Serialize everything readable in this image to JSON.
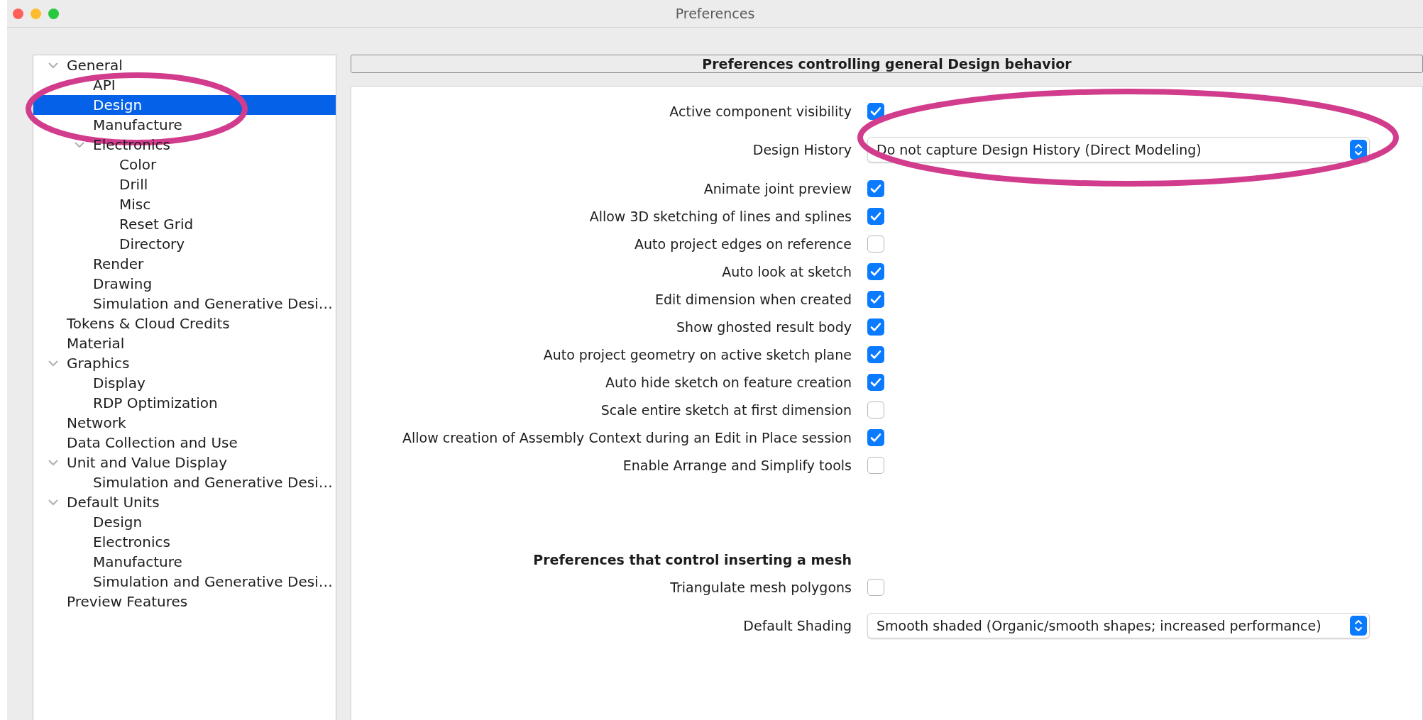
{
  "window": {
    "title": "Preferences"
  },
  "tree": [
    {
      "label": "General",
      "expanded": true,
      "selected": false,
      "children": [
        {
          "label": "API",
          "selected": false
        },
        {
          "label": "Design",
          "selected": true,
          "circled": true
        },
        {
          "label": "Manufacture",
          "selected": false
        },
        {
          "label": "Electronics",
          "expanded": true,
          "selected": false,
          "children": [
            {
              "label": "Color",
              "selected": false
            },
            {
              "label": "Drill",
              "selected": false
            },
            {
              "label": "Misc",
              "selected": false
            },
            {
              "label": "Reset Grid",
              "selected": false
            },
            {
              "label": "Directory",
              "selected": false
            }
          ]
        },
        {
          "label": "Render",
          "selected": false
        },
        {
          "label": "Drawing",
          "selected": false
        },
        {
          "label": "Simulation and Generative Desi…",
          "selected": false
        }
      ]
    },
    {
      "label": "Tokens & Cloud Credits",
      "selected": false
    },
    {
      "label": "Material",
      "selected": false
    },
    {
      "label": "Graphics",
      "expanded": true,
      "selected": false,
      "children": [
        {
          "label": "Display",
          "selected": false
        },
        {
          "label": "RDP Optimization",
          "selected": false
        }
      ]
    },
    {
      "label": "Network",
      "selected": false
    },
    {
      "label": "Data Collection and Use",
      "selected": false
    },
    {
      "label": "Unit and Value Display",
      "expanded": true,
      "selected": false,
      "children": [
        {
          "label": "Simulation and Generative Desi…",
          "selected": false
        }
      ]
    },
    {
      "label": "Default Units",
      "expanded": true,
      "selected": false,
      "children": [
        {
          "label": "Design",
          "selected": false
        },
        {
          "label": "Electronics",
          "selected": false
        },
        {
          "label": "Manufacture",
          "selected": false
        },
        {
          "label": "Simulation and Generative Desi…",
          "selected": false
        }
      ]
    },
    {
      "label": "Preview Features",
      "selected": false
    }
  ],
  "panel": {
    "title": "Preferences controlling general Design behavior",
    "sections": [
      {
        "settings": [
          {
            "kind": "checkbox",
            "label": "Active component visibility",
            "checked": true
          },
          {
            "kind": "dropdown",
            "label": "Design History",
            "value": "Do not capture Design History (Direct Modeling)",
            "circled": true
          },
          {
            "kind": "checkbox",
            "label": "Animate joint preview",
            "checked": true
          },
          {
            "kind": "checkbox",
            "label": "Allow 3D sketching of lines and splines",
            "checked": true
          },
          {
            "kind": "checkbox",
            "label": "Auto project edges on reference",
            "checked": false
          },
          {
            "kind": "checkbox",
            "label": "Auto look at sketch",
            "checked": true
          },
          {
            "kind": "checkbox",
            "label": "Edit dimension when created",
            "checked": true
          },
          {
            "kind": "checkbox",
            "label": "Show ghosted result body",
            "checked": true
          },
          {
            "kind": "checkbox",
            "label": "Auto project geometry on active sketch plane",
            "checked": true
          },
          {
            "kind": "checkbox",
            "label": "Auto hide sketch on feature creation",
            "checked": true
          },
          {
            "kind": "checkbox",
            "label": "Scale entire sketch at first dimension",
            "checked": false
          },
          {
            "kind": "checkbox",
            "label": "Allow creation of Assembly Context during an Edit in Place session",
            "checked": true
          },
          {
            "kind": "checkbox",
            "label": "Enable Arrange and Simplify tools",
            "checked": false
          }
        ]
      },
      {
        "heading": "Preferences that control inserting a mesh",
        "settings": [
          {
            "kind": "checkbox",
            "label": "Triangulate mesh polygons",
            "checked": false
          },
          {
            "kind": "dropdown",
            "label": "Default Shading",
            "value": "Smooth shaded (Organic/smooth shapes; increased performance)"
          }
        ]
      }
    ]
  }
}
